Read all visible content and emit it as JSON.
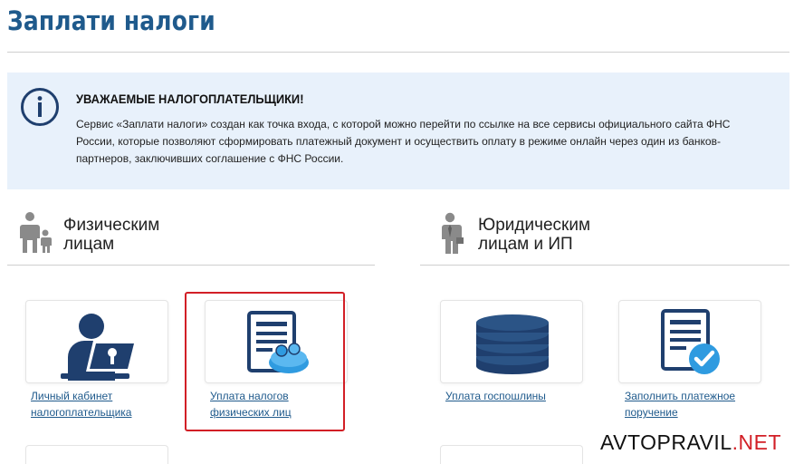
{
  "page": {
    "title": "Заплати налоги"
  },
  "notice": {
    "title": "УВАЖАЕМЫЕ НАЛОГОПЛАТЕЛЬЩИКИ!",
    "text": "Сервис «Заплати налоги» создан как точка входа, с которой можно перейти по ссылке на все сервисы официального сайта ФНС России, которые позволяют сформировать платежный документ и осуществить оплату в режиме онлайн через один из банков-партнеров, заключивших соглашение с ФНС России.",
    "icon": "info-icon"
  },
  "sections": [
    {
      "line1": "Физическим",
      "line2": "лицам",
      "icon": "family-icon",
      "cards": [
        {
          "line1": "Личный кабинет",
          "line2": "налогоплательщика",
          "icon": "user-laptop-icon"
        },
        {
          "line1": "Уплата налогов",
          "line2": "физических лиц",
          "icon": "document-coins-icon"
        }
      ]
    },
    {
      "line1": "Юридическим",
      "line2": "лицам и ИП",
      "icon": "businessman-icon",
      "cards": [
        {
          "line1": "Уплата госпошлины",
          "line2": "",
          "icon": "coin-stack-icon"
        },
        {
          "line1": "Заполнить платежное",
          "line2": "поручение",
          "icon": "document-check-icon"
        }
      ]
    }
  ],
  "watermark": {
    "main": "AVTOPRAVIL",
    "suffix": ".NET"
  },
  "colors": {
    "brand": "#1f5a8c",
    "notice_bg": "#e8f1fb",
    "highlight": "#d21f26"
  }
}
